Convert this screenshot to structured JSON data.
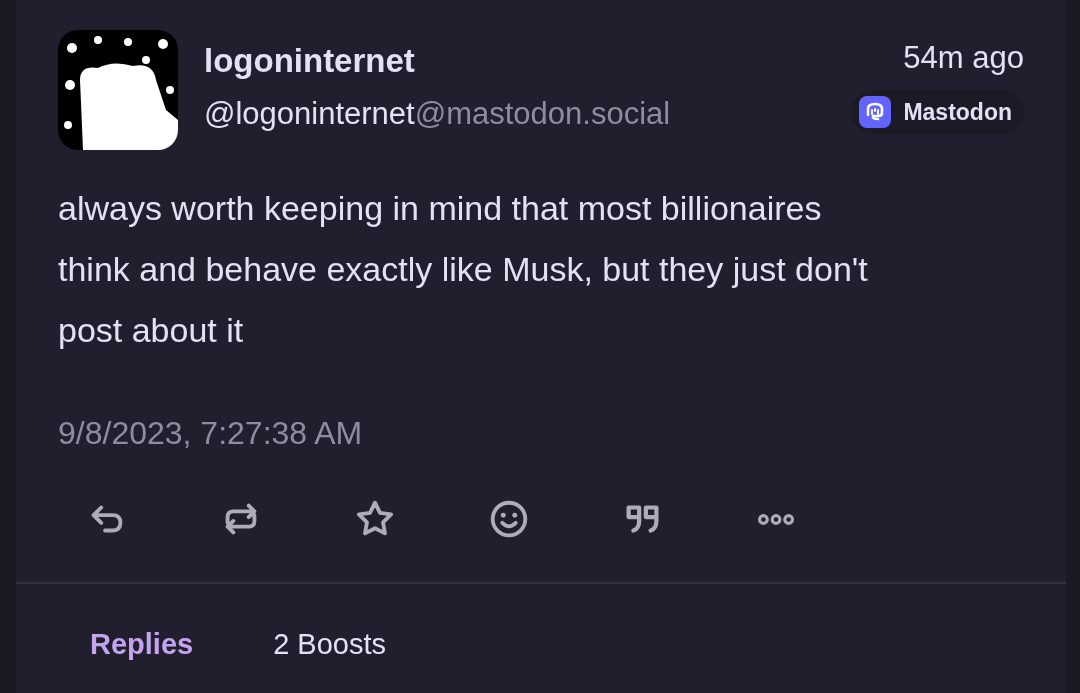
{
  "post": {
    "author": {
      "name": "logoninternet",
      "handle": "@logoninternet",
      "instance": "@mastodon.social"
    },
    "time_ago": "54m ago",
    "platform": "Mastodon",
    "content": "always worth keeping in mind that most billionaires think and behave exactly like Musk, but they just don't post about it",
    "timestamp": "9/8/2023, 7:27:38 AM",
    "actions": [
      {
        "kind": "reply"
      },
      {
        "kind": "boost"
      },
      {
        "kind": "favourite"
      },
      {
        "kind": "react"
      },
      {
        "kind": "quote"
      },
      {
        "kind": "more"
      }
    ]
  },
  "tabs": [
    {
      "label": "Replies",
      "selected": true
    },
    {
      "label": "2 Boosts",
      "selected": false
    }
  ]
}
